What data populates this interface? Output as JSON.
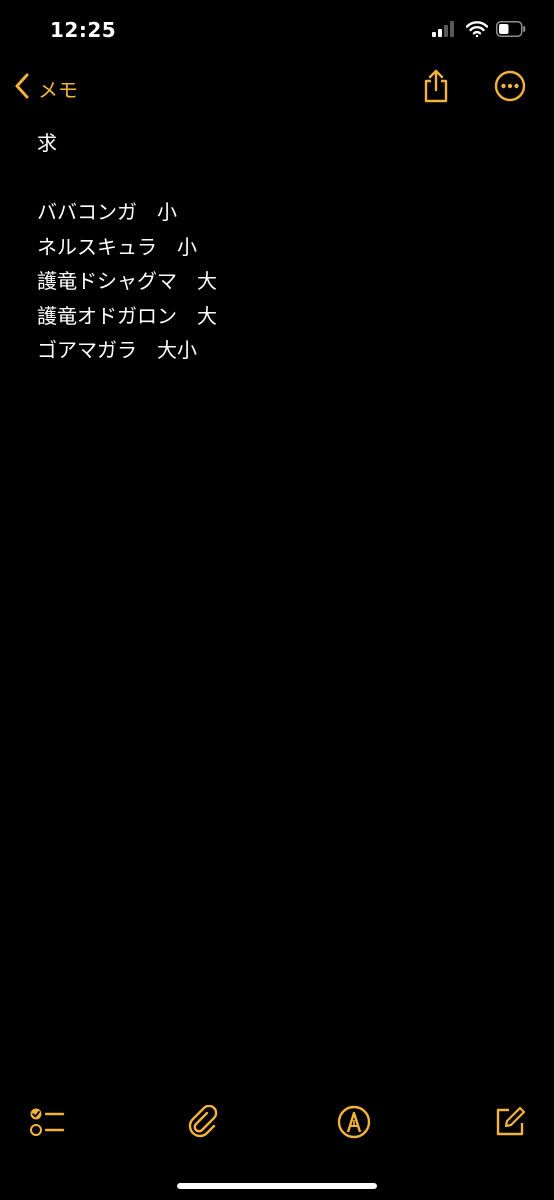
{
  "status_bar": {
    "time": "12:25",
    "signal_icon": "cellular-signal-icon",
    "wifi_icon": "wifi-icon",
    "battery_icon": "battery-icon",
    "battery_level": 0.45
  },
  "nav": {
    "back_label": "メモ",
    "back_icon": "chevron-left-icon",
    "share_icon": "share-icon",
    "more_icon": "ellipsis-circle-icon"
  },
  "note": {
    "lines": [
      "求",
      "",
      "ババコンガ　小",
      "ネルスキュラ　小",
      "護竜ドシャグマ　大",
      "護竜オドガロン　大",
      "ゴアマガラ　大小"
    ]
  },
  "toolbar": {
    "checklist_icon": "checklist-icon",
    "attachment_icon": "paperclip-icon",
    "markup_icon": "markup-pen-icon",
    "compose_icon": "compose-icon"
  },
  "colors": {
    "accent": "#f2b33d",
    "background": "#000000",
    "text": "#ffffff"
  }
}
